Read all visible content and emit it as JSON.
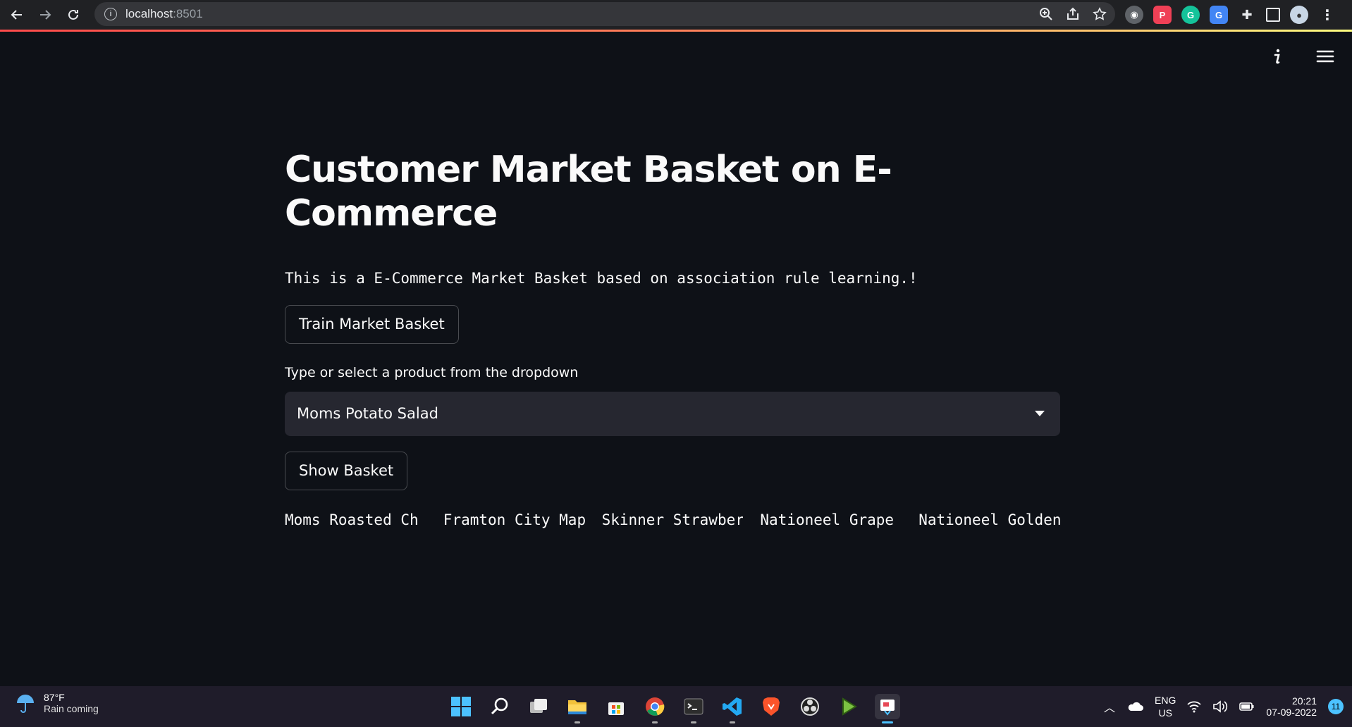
{
  "browser": {
    "url_host": "localhost",
    "url_port": ":8501"
  },
  "app": {
    "title": "Customer Market Basket on E-Commerce",
    "description": "This is a E-Commerce Market Basket based on association rule learning.!",
    "train_button": "Train Market Basket",
    "select_label": "Type or select a product from the dropdown",
    "select_value": "Moms Potato Salad",
    "show_button": "Show Basket",
    "results": [
      "Moms Roasted Ch",
      "Framton City Map",
      "Skinner Strawberry",
      "Nationeel Grape",
      "Nationeel Golden"
    ]
  },
  "taskbar": {
    "temperature": "87°F",
    "weather": "Rain coming",
    "lang_top": "ENG",
    "lang_bottom": "US",
    "time": "20:21",
    "date": "07-09-2022",
    "notifications": "11"
  },
  "colors": {
    "background": "#0e1117",
    "accent": "#ff4b4b",
    "select_bg": "#262730"
  }
}
